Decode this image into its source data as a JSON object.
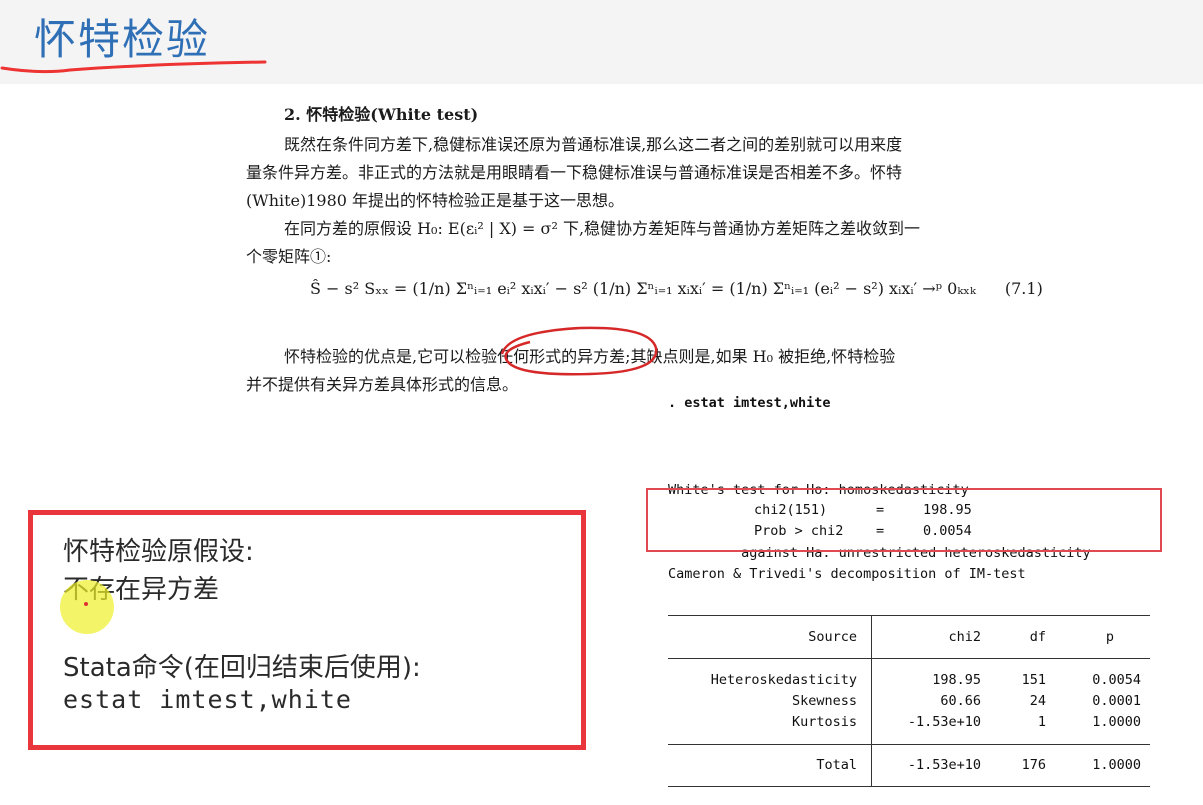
{
  "slide": {
    "title": "怀特检验"
  },
  "textbook": {
    "section_heading": "2. 怀特检验(White test)",
    "lines": [
      "既然在条件同方差下,稳健标准误还原为普通标准误,那么这二者之间的差别就可以用来度",
      "量条件异方差。非正式的方法就是用眼睛看一下稳健标准误与普通标准误是否相差不多。怀特",
      "(White)1980 年提出的怀特检验正是基于这一思想。",
      "在同方差的原假设 H₀: E(εᵢ² | X) = σ² 下,稳健协方差矩阵与普通协方差矩阵之差收敛到一",
      "个零矩阵①:"
    ],
    "formula": "Ŝ − s² Sₓₓ = (1/n) Σⁿᵢ₌₁ eᵢ² xᵢxᵢ′ − s² (1/n) Σⁿᵢ₌₁ xᵢxᵢ′ = (1/n) Σⁿᵢ₌₁ (eᵢ² − s²) xᵢxᵢ′ →ᵖ 0ₖₓₖ",
    "formula_number": "(7.1)",
    "lines2": [
      "怀特检验的优点是,它可以检验任何形式的异方差;其缺点则是,如果 H₀ 被拒绝,怀特检验",
      "并不提供有关异方差具体形式的信息。"
    ]
  },
  "stata": {
    "command": ". estat imtest,white",
    "test_line1": "White's test for Ho: homoskedasticity",
    "test_line2": "         against Ha: unrestricted heteroskedasticity",
    "chi2_label": "chi2(151)",
    "chi2_eq": "=",
    "chi2_value": "198.95",
    "prob_label": "Prob > chi2",
    "prob_eq": "=",
    "prob_value": "0.0054",
    "decomposition_title": "Cameron & Trivedi's decomposition of IM-test",
    "table": {
      "headers": [
        "Source",
        "chi2",
        "df",
        "p"
      ],
      "rows": [
        [
          "Heteroskedasticity",
          "198.95",
          "151",
          "0.0054"
        ],
        [
          "Skewness",
          "60.66",
          "24",
          "0.0001"
        ],
        [
          "Kurtosis",
          "-1.53e+10",
          "1",
          "1.0000"
        ]
      ],
      "total": [
        "Total",
        "-1.53e+10",
        "176",
        "1.0000"
      ]
    }
  },
  "callout": {
    "line1": "怀特检验原假设:",
    "line2": "不存在异方差",
    "line3": "Stata命令(在回归结束后使用):",
    "line4": "estat imtest,white"
  },
  "colors": {
    "title": "#2f6fb6",
    "annotation_red": "#e8363c",
    "highlight": "#f0f028"
  }
}
